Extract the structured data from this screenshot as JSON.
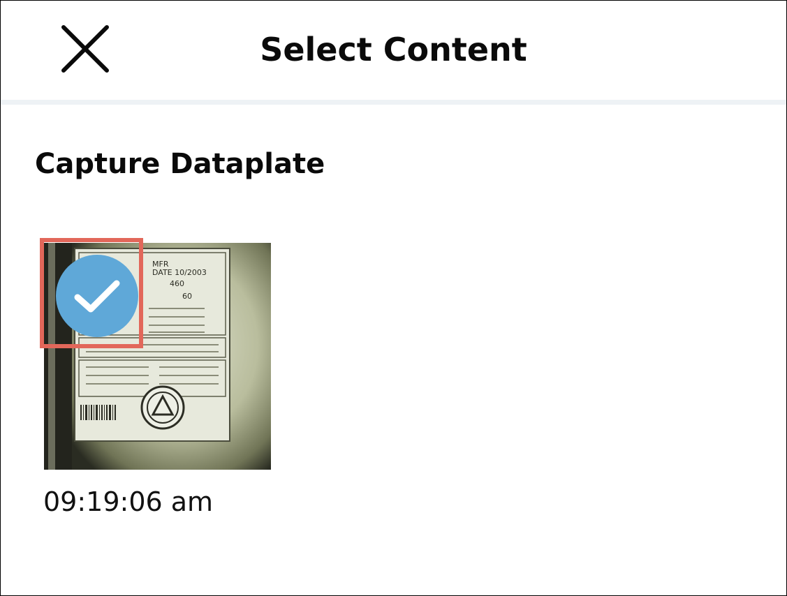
{
  "header": {
    "title": "Select Content",
    "close_icon": "close-icon"
  },
  "section": {
    "title": "Capture Dataplate"
  },
  "items": [
    {
      "time": "09:19:06 am",
      "selected": true,
      "selected_icon": "checkmark-icon",
      "image": "dataplate-photo",
      "image_label_text": {
        "mfr": "MFR",
        "date": "DATE 10/2003",
        "volts": "460",
        "hz": "60"
      }
    }
  ],
  "colors": {
    "header_divider": "#eef2f5",
    "check_badge": "#5fa8d8",
    "highlight": "#e2675a"
  }
}
